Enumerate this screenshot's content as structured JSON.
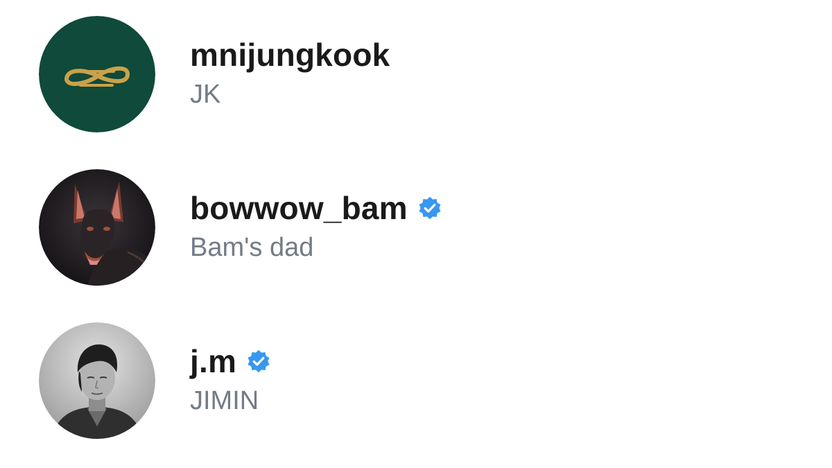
{
  "accounts": [
    {
      "username": "mnijungkook",
      "full_name": "JK",
      "verified": false,
      "avatar_icon": "gold-logo-on-green-avatar",
      "avatar_bg": "#0f4a3a",
      "avatar_accent": "#c9a24a"
    },
    {
      "username": "bowwow_bam",
      "full_name": "Bam's dad",
      "verified": true,
      "avatar_icon": "doberman-dog-avatar",
      "avatar_bg": "#1f1e22"
    },
    {
      "username": "j.m",
      "full_name": "JIMIN",
      "verified": true,
      "avatar_icon": "portrait-photo-avatar",
      "avatar_bg": "#bdbdbd"
    }
  ],
  "colors": {
    "username": "#1a1a1a",
    "full_name": "#737b86",
    "verified_badge": "#3897f0"
  }
}
